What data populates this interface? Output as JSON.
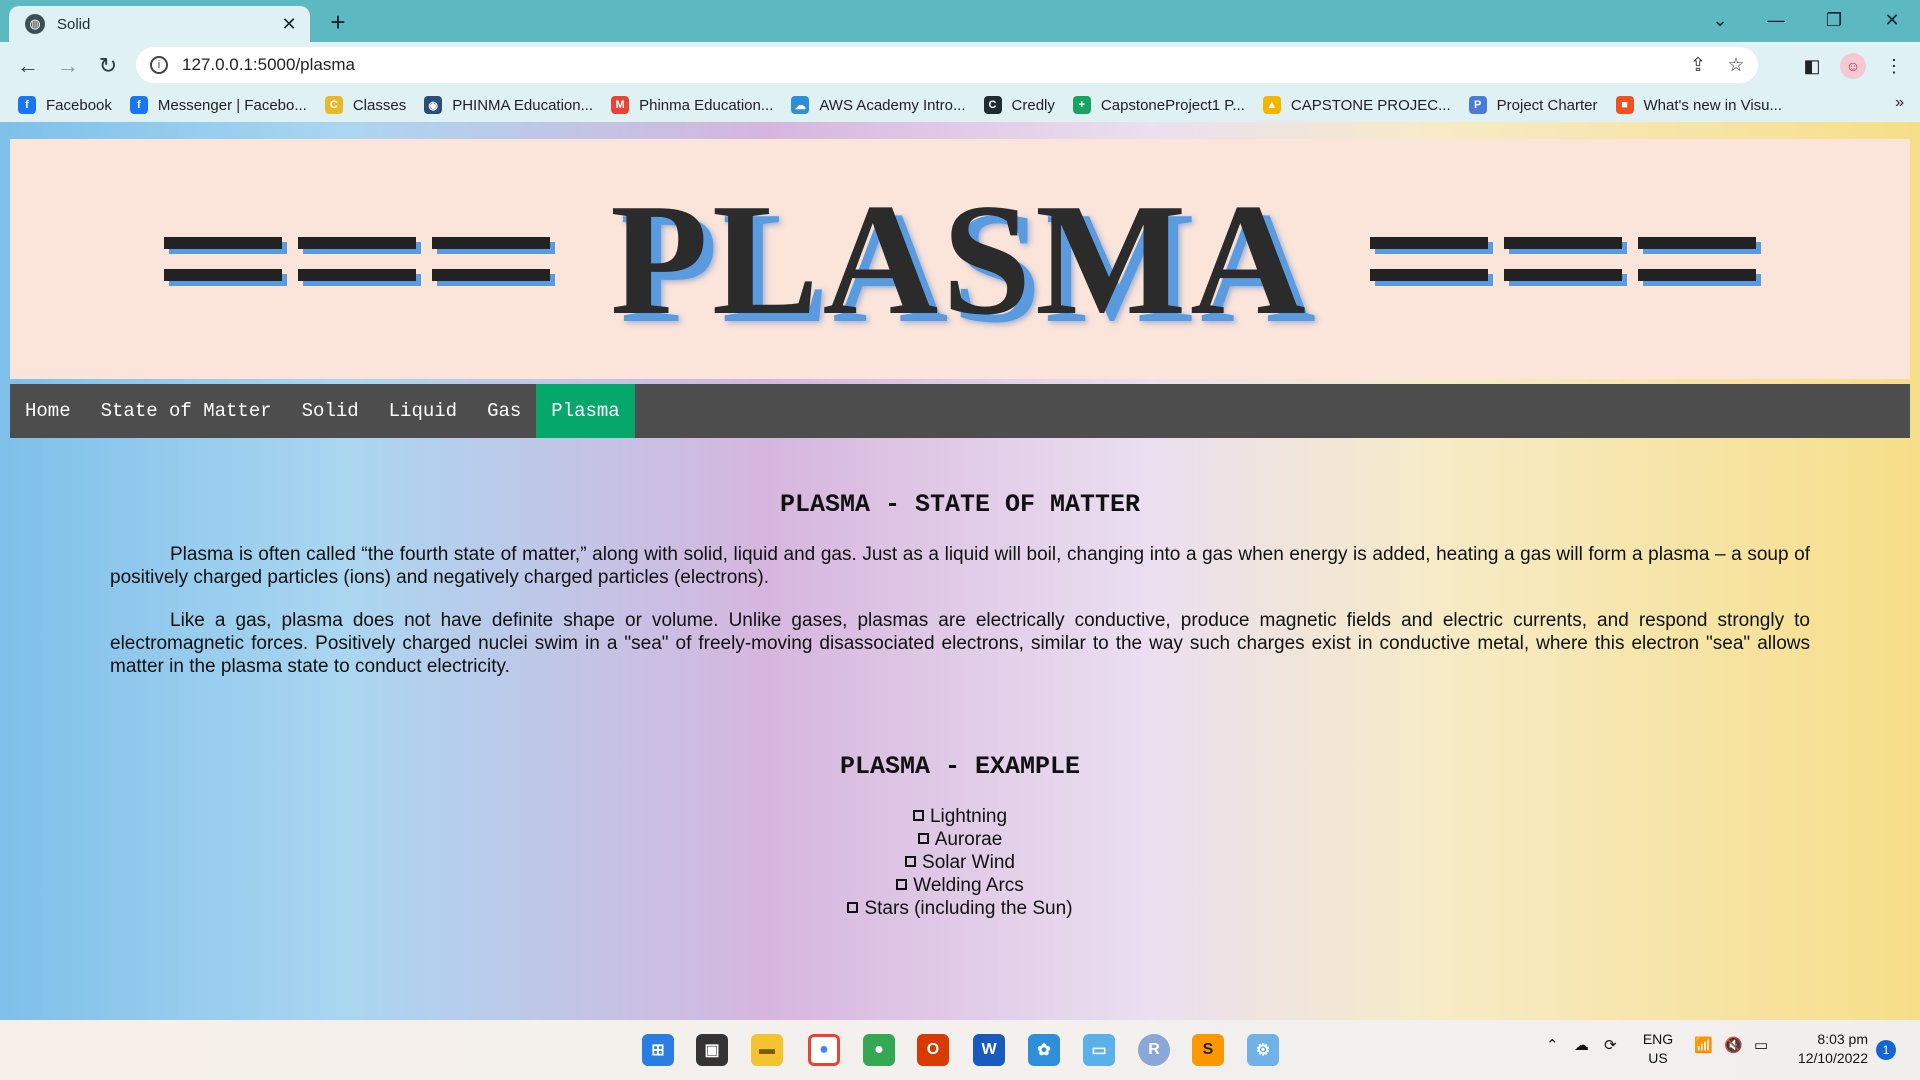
{
  "browser": {
    "tab_title": "Solid",
    "tab_close": "✕",
    "new_tab": "+",
    "url": "127.0.0.1:5000/plasma",
    "bookmarks": [
      {
        "label": "Facebook",
        "color": "#1877f2",
        "glyph": "f"
      },
      {
        "label": "Messenger | Facebo...",
        "color": "#1877f2",
        "glyph": "f"
      },
      {
        "label": "Classes",
        "color": "#e8b92a",
        "glyph": "C"
      },
      {
        "label": "PHINMA Education...",
        "color": "#2a4d7a",
        "glyph": "◉"
      },
      {
        "label": "Phinma Education...",
        "color": "#ea4335",
        "glyph": "M"
      },
      {
        "label": "AWS Academy Intro...",
        "color": "#2d8fd6",
        "glyph": "☁"
      },
      {
        "label": "Credly",
        "color": "#1f2b2e",
        "glyph": "C"
      },
      {
        "label": "CapstoneProject1 P...",
        "color": "#1aa260",
        "glyph": "+"
      },
      {
        "label": "CAPSTONE PROJEC...",
        "color": "#f4b400",
        "glyph": "▲"
      },
      {
        "label": "Project Charter",
        "color": "#4a7bd8",
        "glyph": "P"
      },
      {
        "label": "What's new in Visu...",
        "color": "#f25022",
        "glyph": "■"
      }
    ],
    "more": "»"
  },
  "page": {
    "banner_title": "PLASMA",
    "nav": [
      {
        "label": "Home",
        "active": false
      },
      {
        "label": "State of Matter",
        "active": false
      },
      {
        "label": "Solid",
        "active": false
      },
      {
        "label": "Liquid",
        "active": false
      },
      {
        "label": "Gas",
        "active": false
      },
      {
        "label": "Plasma",
        "active": true
      }
    ],
    "section1_heading": "PLASMA - STATE OF MATTER",
    "paragraph1": "Plasma is often called “the fourth state of matter,” along with solid, liquid and gas. Just as a liquid will boil, changing into a gas when energy is added, heating a gas will form a plasma – a soup of positively charged particles (ions) and negatively charged particles (electrons).",
    "paragraph2": "Like a gas, plasma does not have definite shape or volume. Unlike gases, plasmas are electrically conductive, produce magnetic fields and electric currents, and respond strongly to electromagnetic forces. Positively charged nuclei swim in a \"sea\" of freely-moving disassociated electrons, similar to the way such charges exist in conductive metal, where this electron \"sea\" allows matter in the plasma state to conduct electricity.",
    "section2_heading": "PLASMA - EXAMPLE",
    "examples": [
      "Lightning",
      "Aurorae",
      "Solar Wind",
      "Welding Arcs",
      "Stars (including the Sun)"
    ]
  },
  "taskbar": {
    "language_line1": "ENG",
    "language_line2": "US",
    "time": "8:03 pm",
    "date": "12/10/2022",
    "notification_count": "1"
  },
  "colors": {
    "active_nav": "#05a86a",
    "menu_bg": "#4d4d4d",
    "banner_bg": "#fbe5db",
    "tabstrip": "#5cb9c2"
  }
}
